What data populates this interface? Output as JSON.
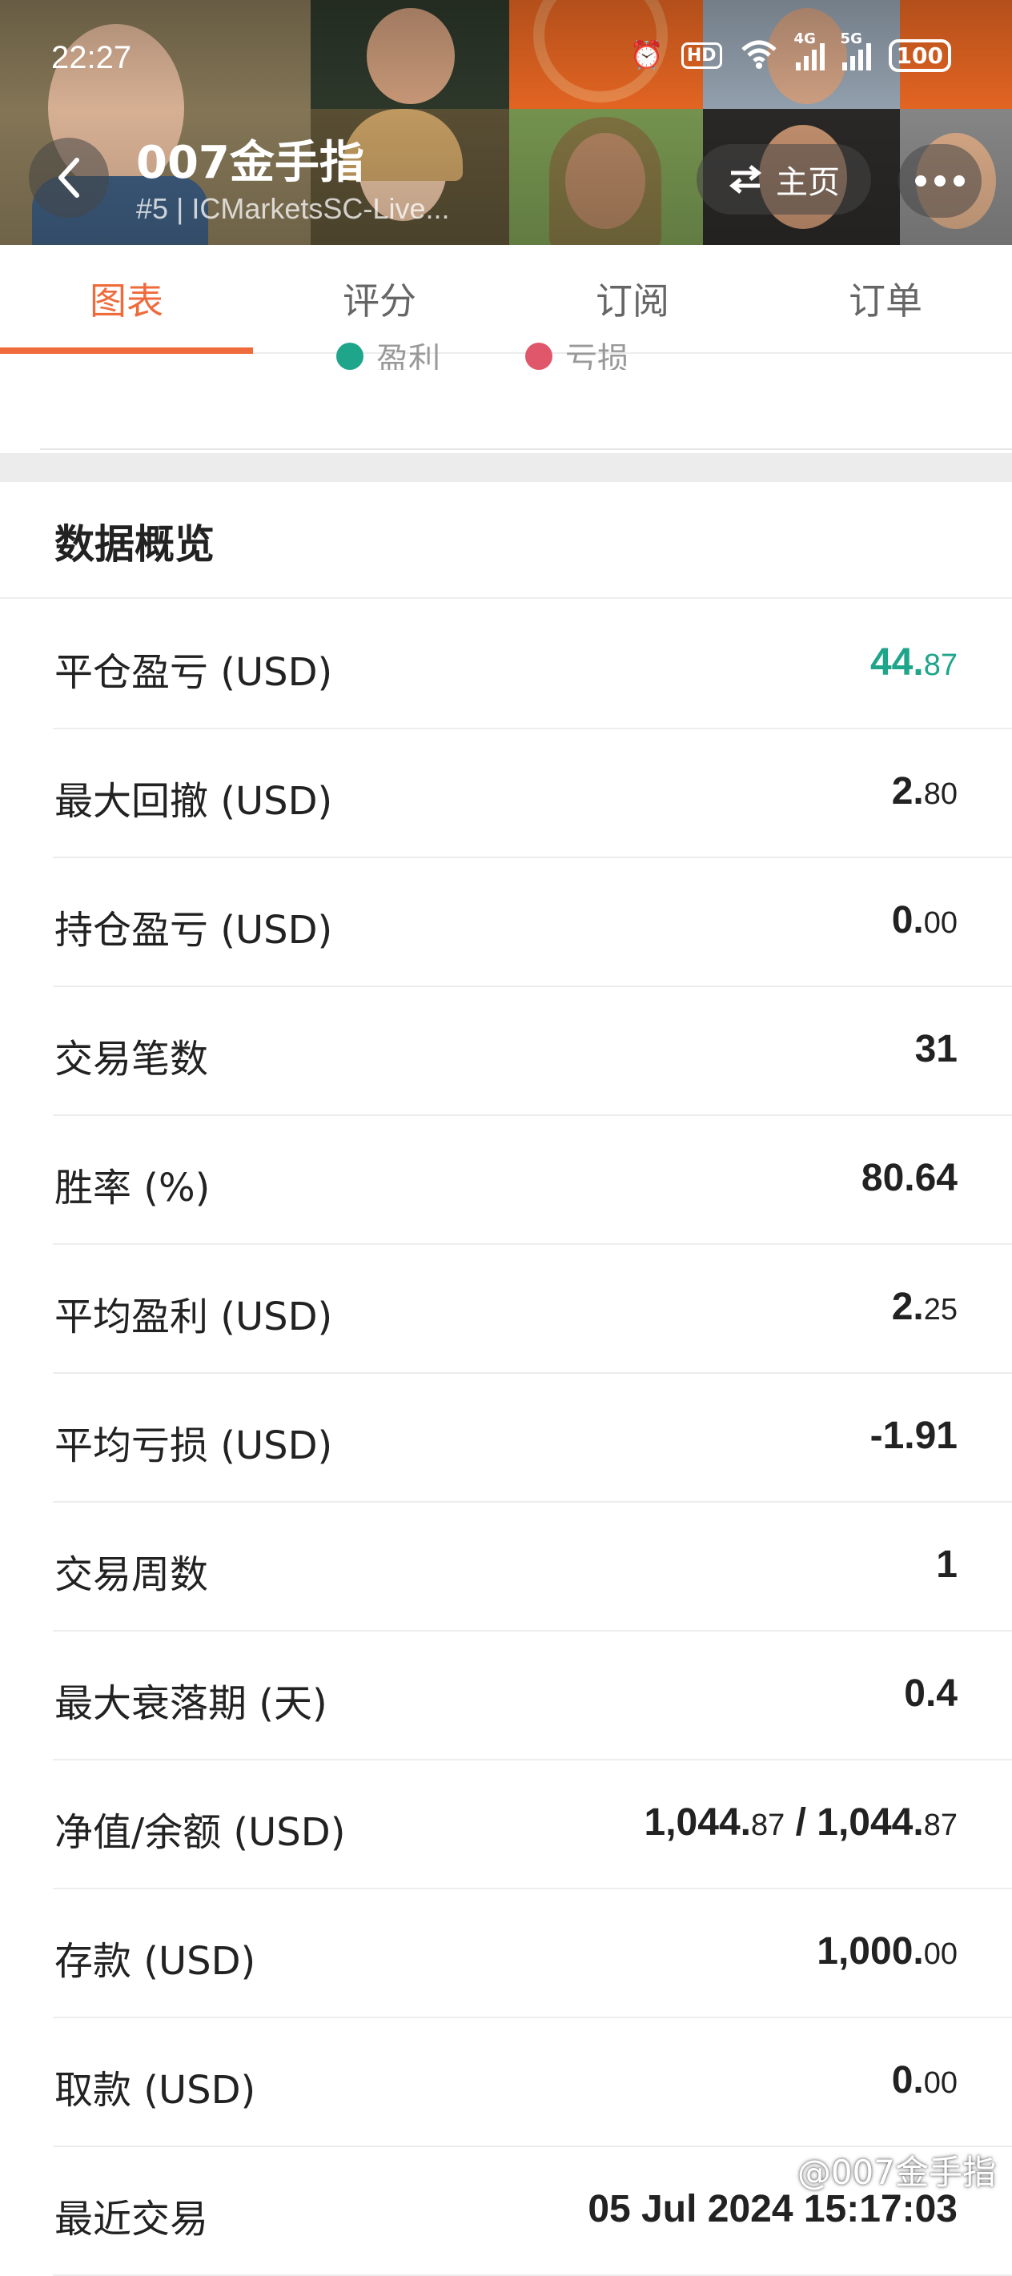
{
  "status_bar": {
    "time": "22:27",
    "hd_label": "HD",
    "net_4g": "4G",
    "net_5g": "5G",
    "battery": "100"
  },
  "header": {
    "title": "007金手指",
    "subtitle": "#5 | ICMarketsSC-Live...",
    "home_label": "主页",
    "accent_color": "#ef6b3c"
  },
  "tabs": [
    {
      "label": "图表",
      "active": true
    },
    {
      "label": "评分",
      "active": false
    },
    {
      "label": "订阅",
      "active": false
    },
    {
      "label": "订单",
      "active": false
    }
  ],
  "legend": [
    {
      "label": "盈利",
      "color": "#1fa58a"
    },
    {
      "label": "亏损",
      "color": "#e0566a"
    }
  ],
  "overview": {
    "title": "数据概览",
    "rows": [
      {
        "label": "平仓盈亏 (USD)",
        "value_int": "44.",
        "value_dec": "87",
        "color": "green"
      },
      {
        "label": "最大回撤 (USD)",
        "value_int": "2.",
        "value_dec": "80"
      },
      {
        "label": "持仓盈亏 (USD)",
        "value_int": "0.",
        "value_dec": "00"
      },
      {
        "label": "交易笔数",
        "value_int": "31",
        "value_dec": ""
      },
      {
        "label": "胜率 (%)",
        "value_int": "80.64",
        "value_dec": ""
      },
      {
        "label": "平均盈利 (USD)",
        "value_int": "2.",
        "value_dec": "25"
      },
      {
        "label": "平均亏损 (USD)",
        "value_int": "-1.91",
        "value_dec": ""
      },
      {
        "label": "交易周数",
        "value_int": "1",
        "value_dec": ""
      },
      {
        "label": "最大衰落期 (天)",
        "value_int": "0.4",
        "value_dec": ""
      },
      {
        "label": "净值/余额 (USD)",
        "value_int": "1,044.",
        "value_dec": "87",
        "value_int2": " / 1,044.",
        "value_dec2": "87"
      },
      {
        "label": "存款 (USD)",
        "value_int": "1,000.",
        "value_dec": "00"
      },
      {
        "label": "取款 (USD)",
        "value_int": "0.",
        "value_dec": "00"
      },
      {
        "label": "最近交易",
        "value_int": "05 Jul 2024 15:17:03",
        "value_dec": ""
      }
    ]
  },
  "watermark": "@007金手指"
}
